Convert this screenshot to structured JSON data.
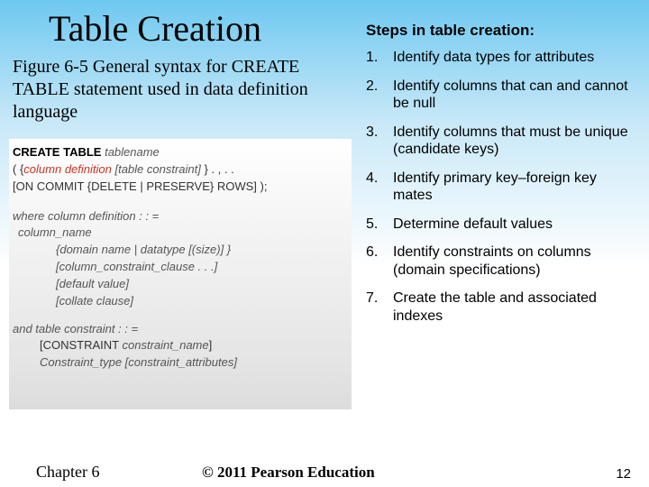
{
  "title": "Table Creation",
  "caption": "Figure 6-5 General syntax for CREATE TABLE statement used in data definition language",
  "syntax": {
    "l1_kw": "CREATE TABLE",
    "l1_it": " tablename",
    "l2a": "( {",
    "l2_red": "column definition",
    "l2b": "  [table constraint]",
    "l2c": " } . , . .",
    "l3": "[ON COMMIT {DELETE | PRESERVE} ROWS] );",
    "l5": "where column definition : : =",
    "l6": "column_name",
    "l7": "{domain name | datatype [(size)] }",
    "l8": "[column_constraint_clause . . .]",
    "l9": "[default value]",
    "l10": "[collate clause]",
    "l11": "and table constraint : : =",
    "l12a": "[CONSTRAINT ",
    "l12b": "constraint_name",
    "l12c": "]",
    "l13a": "Constraint_type ",
    "l13b": "[constraint_attributes]"
  },
  "steps_heading": "Steps in table creation:",
  "steps": [
    "Identify data types for attributes",
    "Identify columns that can and cannot be null",
    "Identify columns that must be unique (candidate keys)",
    "Identify primary key–foreign key mates",
    "Determine default values",
    "Identify constraints on columns (domain specifications)",
    "Create the table and associated indexes"
  ],
  "footer": {
    "chapter": "Chapter 6",
    "copyright": "© 2011 Pearson Education",
    "page": "12"
  }
}
